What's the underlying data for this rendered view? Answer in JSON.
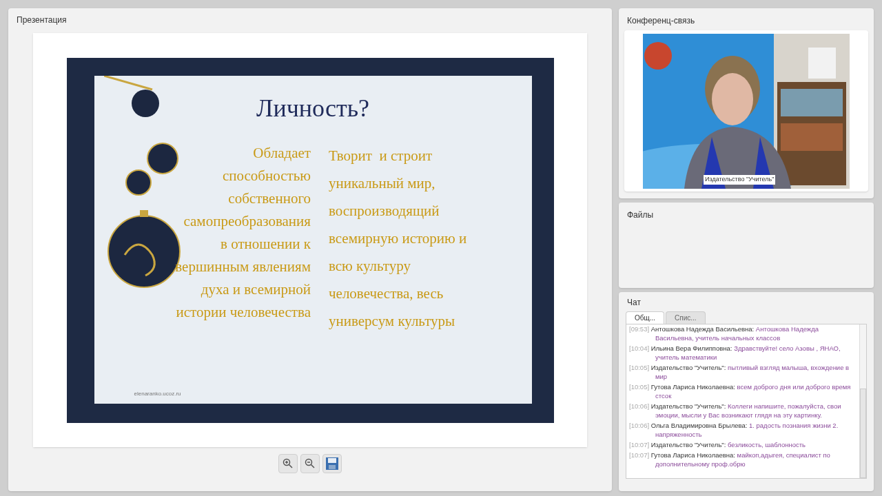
{
  "presentation": {
    "title": "Презентация",
    "slide": {
      "title": "Личность?",
      "left_lines": [
        "Обладает",
        "способностью",
        "собственного",
        "самопреобразования",
        "в отношении к",
        "вершинным явлениям",
        "духа и всемирной",
        "истории человечества"
      ],
      "right_lines": [
        "Творит  и строит",
        "уникальный мир,",
        "воспроизводящий",
        "всемирную историю и",
        "всю культуру",
        "человечества, весь",
        "универсум культуры"
      ],
      "footer": "elenaranko.ucoz.ru"
    }
  },
  "conference": {
    "title": "Конференц-связь",
    "caption": "Издательство \"Учитель\""
  },
  "files": {
    "title": "Файлы"
  },
  "chat": {
    "title": "Чат",
    "tabs": [
      {
        "label": "Общ...",
        "selected": true
      },
      {
        "label": "Спис...",
        "selected": false
      }
    ],
    "messages": [
      {
        "time": "[09:53]",
        "author": "Антошкова Надежда Васильевна:",
        "text": "Антошкова Надежда Васильевна, учитель начальных классов"
      },
      {
        "time": "[10:04]",
        "author": "Ильина Вера Филипповна:",
        "text": "Здравствуйте! село Азовы , ЯНАО, учитель математики"
      },
      {
        "time": "[10:05]",
        "author": "Издательство \"Учитель\":",
        "text": "пытливый взгляд малыша, вхождение в мир"
      },
      {
        "time": "[10:05]",
        "author": "Гутова Лариса Николаевна:",
        "text": "всем доброго дня или доброго время стсок"
      },
      {
        "time": "[10:06]",
        "author": "Издательство \"Учитель\":",
        "text": "Коллеги напишите, пожалуйста, свои эмоции, мысли у Вас возникают глядя на эту картинку."
      },
      {
        "time": "[10:06]",
        "author": "Ольга Владимировна Брылева:",
        "text": "1. радость познания жизни 2. напряженность"
      },
      {
        "time": "[10:07]",
        "author": "Издательство \"Учитель\":",
        "text": "безликость, шаблонность"
      },
      {
        "time": "[10:07]",
        "author": "Гутова Лариса Николаевна:",
        "text": "майкоп,адыгея, специалист по дополнительному проф.обрю"
      }
    ]
  }
}
